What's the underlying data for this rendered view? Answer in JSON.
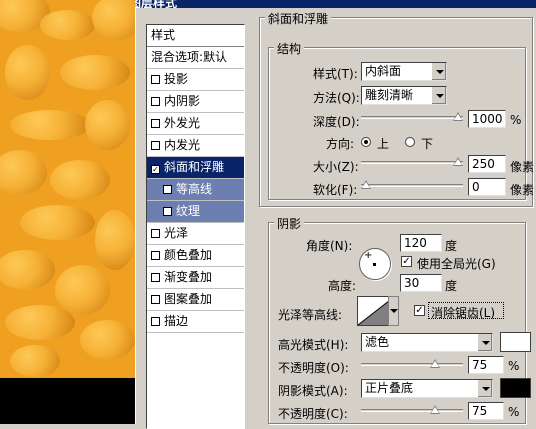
{
  "window": {
    "title": "图层样式"
  },
  "style_list": {
    "header": "样式",
    "blend_options": "混合选项:默认",
    "items": [
      {
        "label": "投影",
        "checked": false
      },
      {
        "label": "内阴影",
        "checked": false
      },
      {
        "label": "外发光",
        "checked": false
      },
      {
        "label": "内发光",
        "checked": false
      },
      {
        "label": "斜面和浮雕",
        "checked": true,
        "selected": true
      },
      {
        "label": "等高线",
        "checked": false,
        "sub": true
      },
      {
        "label": "纹理",
        "checked": false,
        "sub": true
      },
      {
        "label": "光泽",
        "checked": false
      },
      {
        "label": "颜色叠加",
        "checked": false
      },
      {
        "label": "渐变叠加",
        "checked": false
      },
      {
        "label": "图案叠加",
        "checked": false
      },
      {
        "label": "描边",
        "checked": false
      }
    ]
  },
  "bevel": {
    "section_title": "斜面和浮雕",
    "structure": {
      "title": "结构",
      "style_label": "样式(T):",
      "style_value": "内斜面",
      "technique_label": "方法(Q):",
      "technique_value": "雕刻清晰",
      "depth_label": "深度(D):",
      "depth_value": "1000",
      "depth_unit": "%",
      "direction_label": "方向:",
      "direction_up": "上",
      "direction_down": "下",
      "size_label": "大小(Z):",
      "size_value": "250",
      "size_unit": "像素",
      "soften_label": "软化(F):",
      "soften_value": "0",
      "soften_unit": "像素"
    },
    "shading": {
      "title": "阴影",
      "angle_label": "角度(N):",
      "angle_value": "120",
      "angle_unit": "度",
      "global_light_label": "使用全局光(G)",
      "altitude_label": "高度:",
      "altitude_value": "30",
      "altitude_unit": "度",
      "gloss_label": "光泽等高线:",
      "antialias_label": "消除锯齿(L)",
      "highlight_label": "高光模式(H):",
      "highlight_value": "滤色",
      "highlight_color": "#ffffff",
      "opacity1_label": "不透明度(O):",
      "opacity1_value": "75",
      "opacity1_unit": "%",
      "shadow_label": "阴影模式(A):",
      "shadow_value": "正片叠底",
      "shadow_color": "#000000",
      "opacity2_label": "不透明度(C):",
      "opacity2_value": "75",
      "opacity2_unit": "%"
    }
  },
  "slider_levels": {
    "depth": 1.0,
    "size": 1.0,
    "soften": 0.0,
    "opacity1": 0.75,
    "opacity2": 0.75
  }
}
